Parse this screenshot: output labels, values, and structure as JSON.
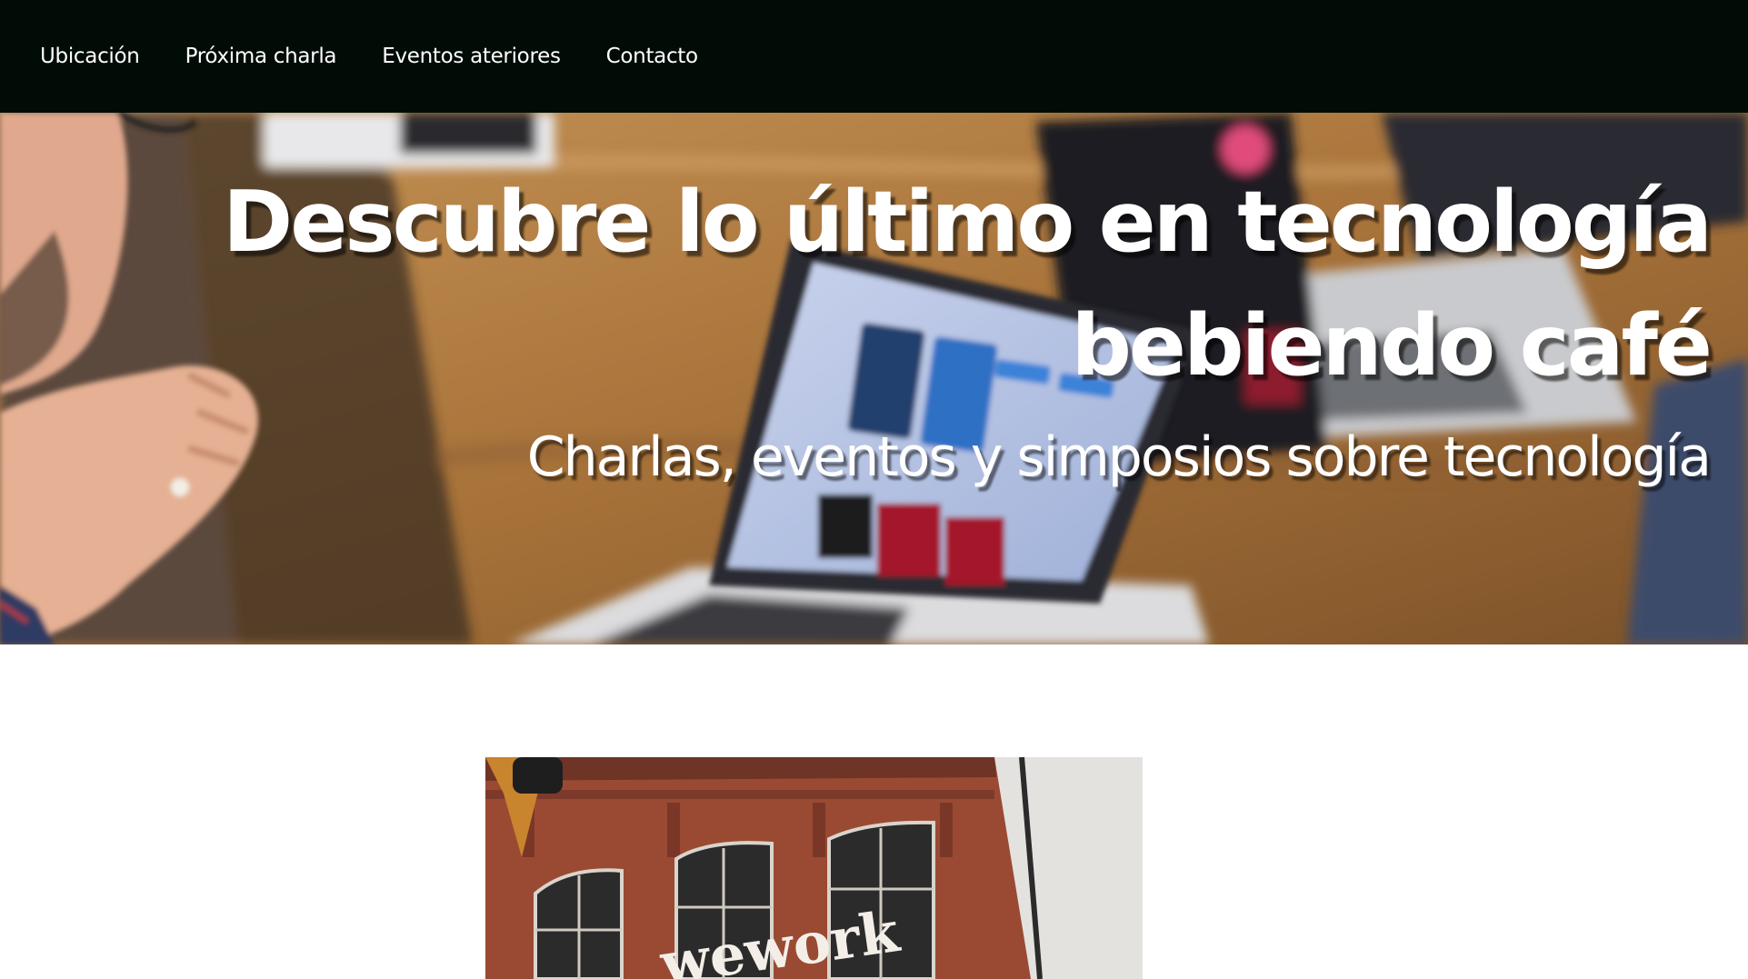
{
  "nav": {
    "items": [
      {
        "label": "Ubicación"
      },
      {
        "label": "Próxima charla"
      },
      {
        "label": "Eventos ateriores"
      },
      {
        "label": "Contacto"
      }
    ]
  },
  "hero": {
    "title": "Descubre lo último en tecnología bebiendo café",
    "subtitle": "Charlas, eventos y simposios sobre tecnología",
    "background_image": "blurred-laptops-on-wooden-table-photo"
  },
  "venue": {
    "image": "wework-brick-building-photo",
    "sign_text": "wework"
  },
  "colors": {
    "nav_background": "#010c07",
    "nav_text": "#ffffff",
    "hero_text": "#ffffff",
    "page_background": "#ffffff"
  }
}
